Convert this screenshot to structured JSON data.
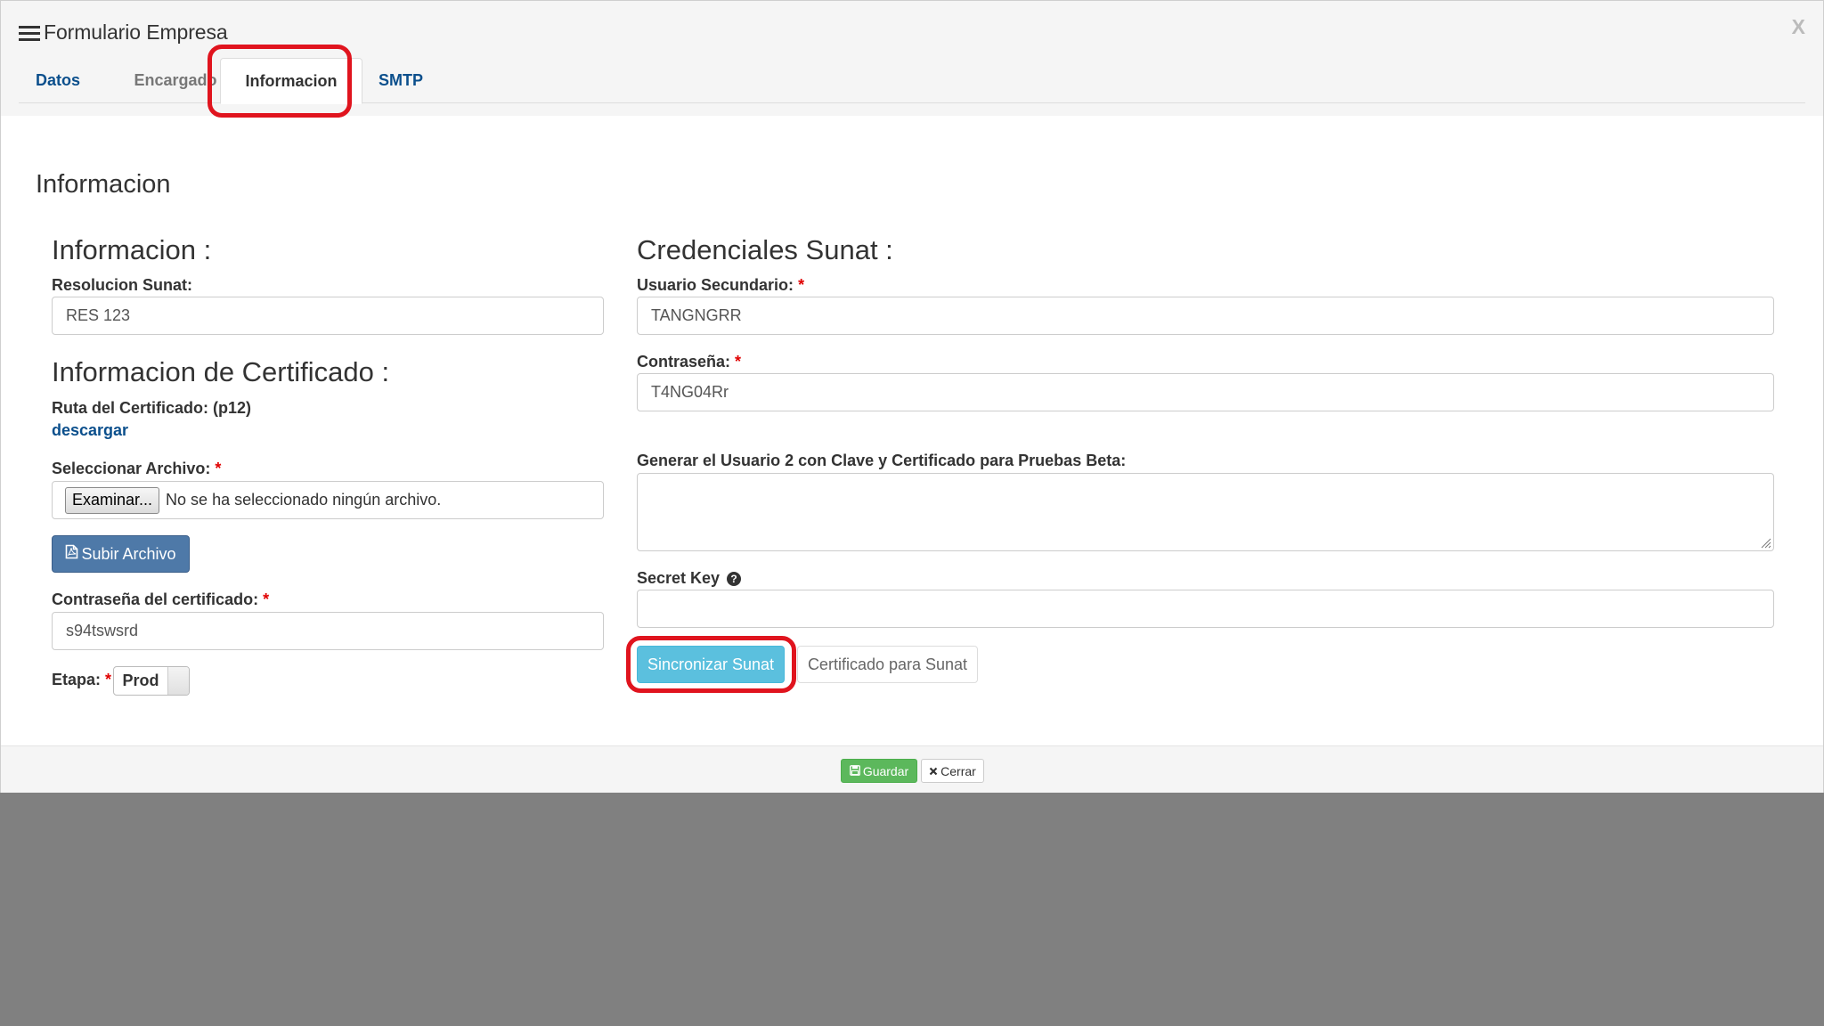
{
  "modal": {
    "title": "Formulario Empresa",
    "close_label": "X"
  },
  "tabs": [
    {
      "label": "Datos"
    },
    {
      "label": "Encargado"
    },
    {
      "label": "Informacion"
    },
    {
      "label": "SMTP"
    }
  ],
  "active_tab": "Informacion",
  "section_title": "Informacion",
  "left": {
    "info_title": "Informacion :",
    "resolucion_label": "Resolucion Sunat:",
    "resolucion_value": "RES 123",
    "cert_title": "Informacion de Certificado :",
    "ruta_label": "Ruta del Certificado: (p12)",
    "descargar_link": "descargar",
    "archivo_label": "Seleccionar Archivo:",
    "file_button": "Examinar...",
    "file_status": "No se ha seleccionado ningún archivo.",
    "upload_button": "Subir Archivo",
    "cert_password_label": "Contraseña del certificado:",
    "cert_password_value": "s94tswsrd",
    "etapa_label": "Etapa:",
    "etapa_value": "Prod"
  },
  "right": {
    "cred_title": "Credenciales Sunat :",
    "usuario_label": "Usuario Secundario:",
    "usuario_value": "TANGNGRR",
    "password_label": "Contraseña:",
    "password_value": "T4NG04Rr",
    "generar_label": "Generar el Usuario 2 con Clave y Certificado para Pruebas Beta:",
    "generar_value": "",
    "secret_label": "Secret Key",
    "secret_value": "",
    "sync_button": "Sincronizar Sunat",
    "cert_button": "Certificado para Sunat"
  },
  "footer": {
    "save_button": "Guardar",
    "close_button": "Cerrar"
  },
  "required_marker": "*",
  "colors": {
    "highlight": "#e0141e",
    "link": "#0b4f8c",
    "sync_button": "#5bc0de",
    "upload_button": "#4e79a8",
    "save_button": "#5cb85c"
  },
  "icons": [
    "menu-icon",
    "pdf-file-icon",
    "question-circle-icon",
    "save-icon",
    "close-icon"
  ]
}
